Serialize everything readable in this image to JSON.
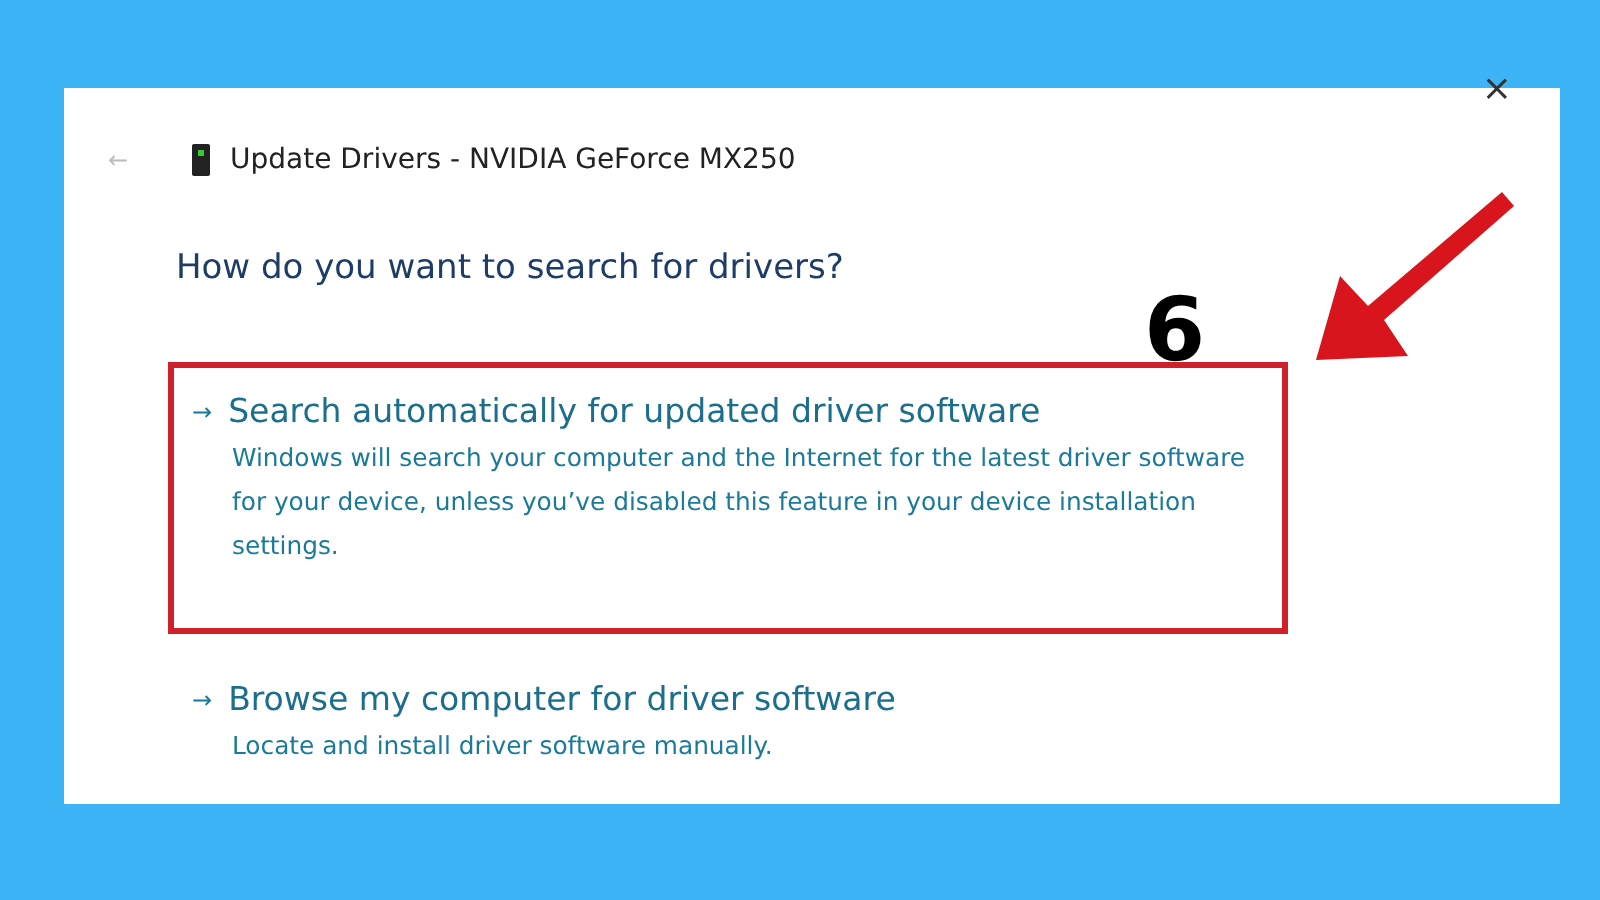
{
  "window": {
    "close": "×",
    "back": "←",
    "title": "Update Drivers - NVIDIA GeForce MX250"
  },
  "heading": "How do you want to search for drivers?",
  "options": [
    {
      "arrow": "→",
      "title": "Search automatically for updated driver software",
      "description": "Windows will search your computer and the Internet for the latest driver software for your device, unless you’ve disabled this feature in your device installation settings.",
      "highlighted": true
    },
    {
      "arrow": "→",
      "title": "Browse my computer for driver software",
      "description": "Locate and install driver software manually.",
      "highlighted": false
    }
  ],
  "annotation": {
    "step": "6"
  }
}
